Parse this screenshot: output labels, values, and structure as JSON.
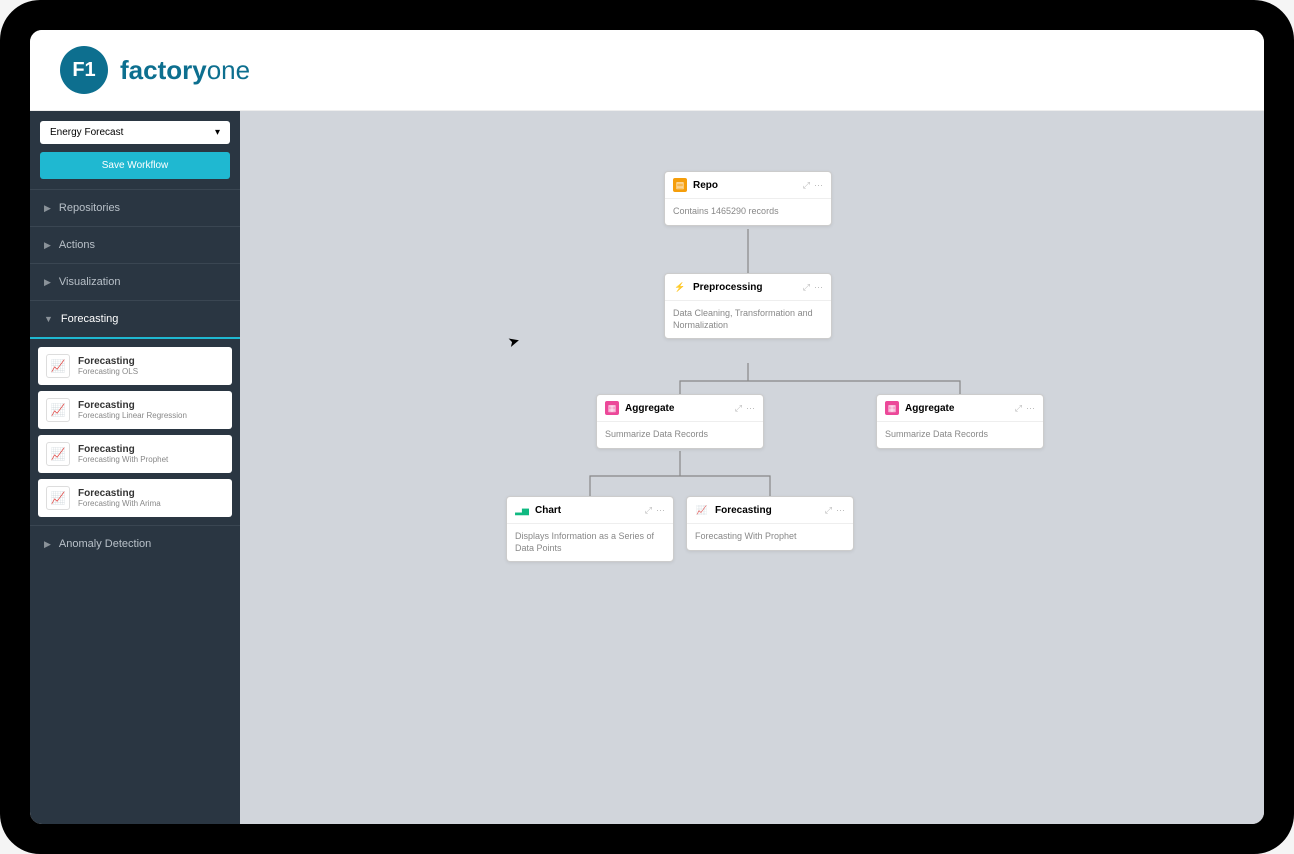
{
  "brand": {
    "badge": "F1",
    "name_bold": "factory",
    "name_light": "one"
  },
  "sidebar": {
    "dropdown_selected": "Energy Forecast",
    "save_label": "Save Workflow",
    "collapse_glyph": "≪",
    "sections": [
      {
        "label": "Repositories"
      },
      {
        "label": "Actions"
      },
      {
        "label": "Visualization"
      },
      {
        "label": "Forecasting"
      },
      {
        "label": "Anomaly Detection"
      }
    ],
    "tools": [
      {
        "title": "Forecasting",
        "sub": "Forecasting OLS"
      },
      {
        "title": "Forecasting",
        "sub": "Forecasting Linear Regression"
      },
      {
        "title": "Forecasting",
        "sub": "Forecasting With Prophet"
      },
      {
        "title": "Forecasting",
        "sub": "Forecasting With Arima"
      }
    ]
  },
  "nodes": {
    "repo": {
      "title": "Repo",
      "body": "Contains 1465290 records"
    },
    "preprocess": {
      "title": "Preprocessing",
      "body": "Data Cleaning, Transformation and Normalization"
    },
    "aggregate_l": {
      "title": "Aggregate",
      "body": "Summarize Data Records"
    },
    "aggregate_r": {
      "title": "Aggregate",
      "body": "Summarize Data Records"
    },
    "chart": {
      "title": "Chart",
      "body": "Displays Information as a Series of Data Points"
    },
    "forecast": {
      "title": "Forecasting",
      "body": "Forecasting With Prophet"
    }
  },
  "node_actions": {
    "expand": "⤢",
    "menu": "⋯"
  }
}
